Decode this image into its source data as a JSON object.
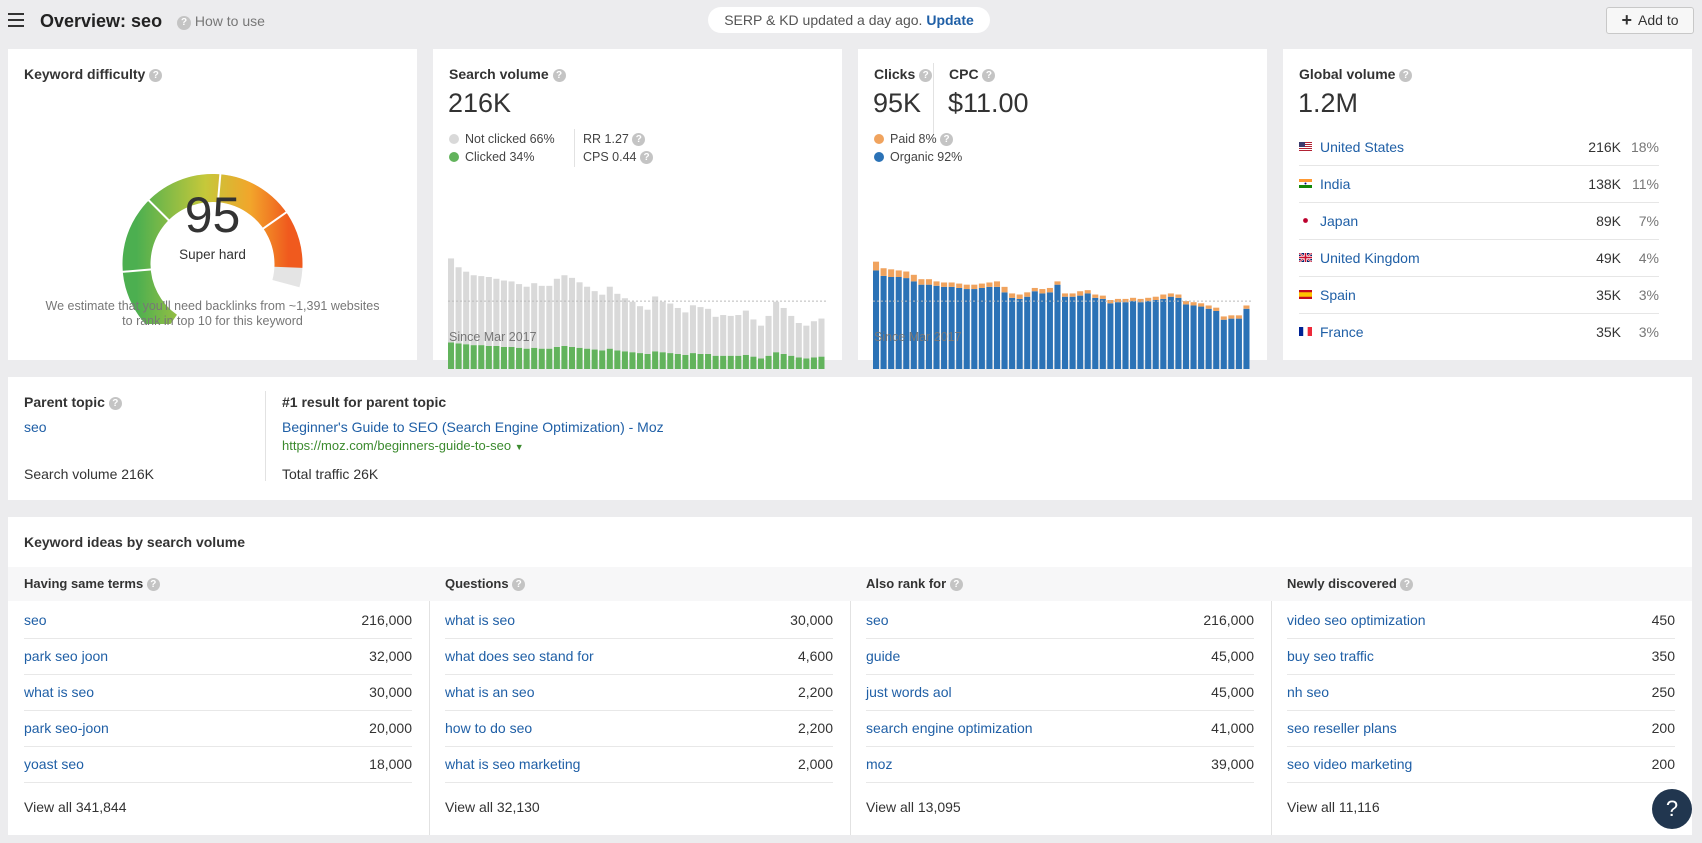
{
  "header": {
    "title": "Overview: seo",
    "how_to_use": "How to use",
    "notice_text": "SERP & KD updated a day ago.",
    "notice_link": "Update",
    "add_to": "Add to"
  },
  "kd": {
    "title": "Keyword difficulty",
    "value": "95",
    "label": "Super hard",
    "fill_fraction": 0.95,
    "note_line1": "We estimate that you'll need backlinks from ~1,391 websites",
    "note_line2": "to rank in top 10 for this keyword"
  },
  "search_volume": {
    "title": "Search volume",
    "value": "216K",
    "legend": [
      "Not clicked 66%",
      "Clicked 34%"
    ],
    "rr": "RR 1.27",
    "cps": "CPS 0.44",
    "since": "Since Mar 2017",
    "colors": {
      "not_clicked": "#d9d9d9",
      "clicked": "#62b35c"
    }
  },
  "clicks": {
    "title": "Clicks",
    "value": "95K",
    "cpc_title": "CPC",
    "cpc_value": "$11.00",
    "legend": [
      "Paid 8%",
      "Organic 92%"
    ],
    "since": "Since Mar 2017",
    "colors": {
      "paid": "#f0a35e",
      "organic": "#2b72b6"
    }
  },
  "global_volume": {
    "title": "Global volume",
    "value": "1.2M",
    "countries": [
      {
        "name": "United States",
        "volume": "216K",
        "pct": "18%",
        "flag": "us"
      },
      {
        "name": "India",
        "volume": "138K",
        "pct": "11%",
        "flag": "in"
      },
      {
        "name": "Japan",
        "volume": "89K",
        "pct": "7%",
        "flag": "jp"
      },
      {
        "name": "United Kingdom",
        "volume": "49K",
        "pct": "4%",
        "flag": "gb"
      },
      {
        "name": "Spain",
        "volume": "35K",
        "pct": "3%",
        "flag": "es"
      },
      {
        "name": "France",
        "volume": "35K",
        "pct": "3%",
        "flag": "fr"
      }
    ]
  },
  "parent_topic": {
    "title": "Parent topic",
    "keyword": "seo",
    "search_volume": "Search volume 216K",
    "result_title": "#1 result for parent topic",
    "result_link": "Beginner's Guide to SEO (Search Engine Optimization) - Moz",
    "result_url": "https://moz.com/beginners-guide-to-seo",
    "total_traffic": "Total traffic 26K"
  },
  "ideas": {
    "title": "Keyword ideas by search volume",
    "columns": [
      {
        "header": "Having same terms",
        "view_all": "View all 341,844",
        "rows": [
          [
            "seo",
            "216,000"
          ],
          [
            "park seo joon",
            "32,000"
          ],
          [
            "what is seo",
            "30,000"
          ],
          [
            "park seo-joon",
            "20,000"
          ],
          [
            "yoast seo",
            "18,000"
          ]
        ]
      },
      {
        "header": "Questions",
        "view_all": "View all 32,130",
        "rows": [
          [
            "what is seo",
            "30,000"
          ],
          [
            "what does seo stand for",
            "4,600"
          ],
          [
            "what is an seo",
            "2,200"
          ],
          [
            "how to do seo",
            "2,200"
          ],
          [
            "what is seo marketing",
            "2,000"
          ]
        ]
      },
      {
        "header": "Also rank for",
        "view_all": "View all 13,095",
        "rows": [
          [
            "seo",
            "216,000"
          ],
          [
            "guide",
            "45,000"
          ],
          [
            "just words aol",
            "45,000"
          ],
          [
            "search engine optimization",
            "41,000"
          ],
          [
            "moz",
            "39,000"
          ]
        ]
      },
      {
        "header": "Newly discovered",
        "view_all": "View all 11,116",
        "rows": [
          [
            "video seo optimization",
            "450"
          ],
          [
            "buy seo traffic",
            "350"
          ],
          [
            "nh seo",
            "250"
          ],
          [
            "seo reseller plans",
            "200"
          ],
          [
            "seo video marketing",
            "200"
          ]
        ]
      }
    ]
  },
  "help_button": "?",
  "chart_data": [
    {
      "type": "bar",
      "series": [
        {
          "name": "Not clicked",
          "values": [
            95,
            86,
            82,
            79,
            78,
            78,
            76,
            75,
            74,
            72,
            70,
            73,
            71,
            71,
            77,
            80,
            78,
            74,
            70,
            66,
            63,
            70,
            64,
            60,
            57,
            53,
            50,
            62,
            57,
            56,
            52,
            48,
            54,
            53,
            51,
            44,
            46,
            45,
            46,
            50,
            42,
            37,
            45,
            57,
            52,
            45,
            39,
            37,
            41,
            43
          ]
        },
        {
          "name": "Clicked",
          "values": [
            30,
            29,
            28,
            27,
            27,
            26,
            26,
            25,
            25,
            24,
            23,
            24,
            23,
            23,
            25,
            26,
            25,
            24,
            23,
            22,
            21,
            23,
            21,
            20,
            19,
            18,
            17,
            20,
            19,
            18,
            17,
            16,
            18,
            17,
            17,
            15,
            15,
            15,
            15,
            16,
            14,
            12,
            15,
            19,
            17,
            15,
            13,
            12,
            13,
            14
          ]
        }
      ]
    },
    {
      "type": "bar",
      "series": [
        {
          "name": "Paid",
          "values": [
            8,
            7,
            7,
            6,
            6,
            6,
            5,
            5,
            4,
            4,
            4,
            4,
            4,
            4,
            4,
            4,
            5,
            5,
            4,
            4,
            4,
            3,
            4,
            4,
            3,
            3,
            3,
            4,
            3,
            3,
            3,
            3,
            3,
            3,
            3,
            3,
            3,
            3,
            4,
            3,
            3,
            3,
            3,
            3,
            3,
            3,
            3,
            3,
            3,
            3
          ]
        },
        {
          "name": "Organic",
          "values": [
            90,
            85,
            84,
            84,
            83,
            80,
            77,
            77,
            76,
            75,
            75,
            74,
            73,
            73,
            74,
            75,
            75,
            70,
            65,
            64,
            66,
            71,
            69,
            70,
            77,
            66,
            66,
            67,
            69,
            65,
            64,
            60,
            61,
            61,
            62,
            61,
            62,
            63,
            64,
            66,
            65,
            59,
            58,
            57,
            55,
            53,
            45,
            46,
            46,
            55
          ]
        }
      ]
    }
  ]
}
